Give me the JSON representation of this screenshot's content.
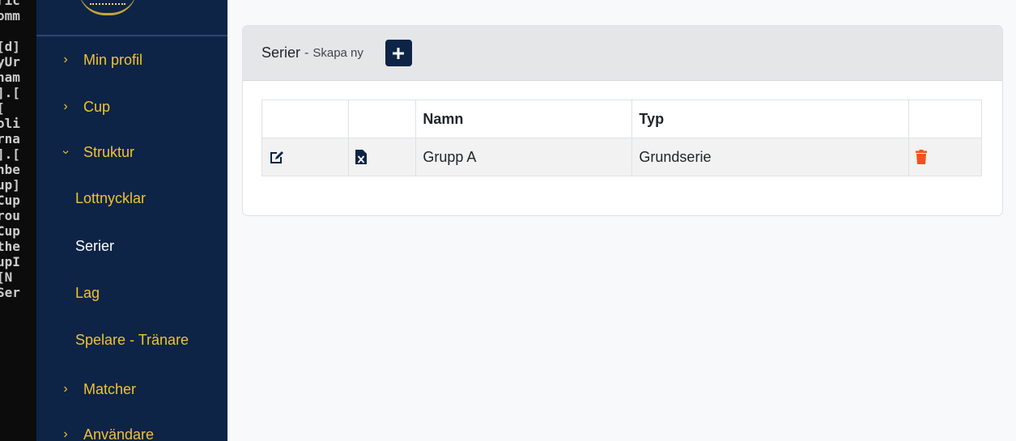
{
  "terminal": {
    "lines": [
      "ric",
      "omm",
      "",
      "[d]",
      "yUr",
      "nam",
      "].[",
      " [",
      "oli",
      "rna",
      "].[",
      "nbe",
      "up]",
      "Cup",
      "rou",
      "Cup",
      "the",
      "upI",
      " [N",
      "Ser"
    ]
  },
  "sidebar": {
    "items": [
      {
        "label": "Min profil",
        "chevron": "›"
      },
      {
        "label": "Cup",
        "chevron": "›"
      },
      {
        "label": "Struktur",
        "chevron": "›"
      },
      {
        "label": "Matcher",
        "chevron": "›"
      },
      {
        "label": "Användare",
        "chevron": "›"
      }
    ],
    "sub_items": [
      {
        "label": "Lottnycklar"
      },
      {
        "label": "Serier"
      },
      {
        "label": "Lag"
      },
      {
        "label": "Spelare - Tränare"
      }
    ]
  },
  "card": {
    "title": "Serier",
    "separator": "-",
    "subtitle": "Skapa ny",
    "add_label": "+"
  },
  "table": {
    "headers": [
      "",
      "",
      "Namn",
      "Typ",
      ""
    ],
    "rows": [
      {
        "name": "Grupp A",
        "type": "Grundserie"
      }
    ]
  },
  "colors": {
    "sidebar_bg": "#0d2447",
    "nav_text": "#f2c230",
    "active_text": "#ffffff",
    "delete_icon": "#f4511e"
  }
}
